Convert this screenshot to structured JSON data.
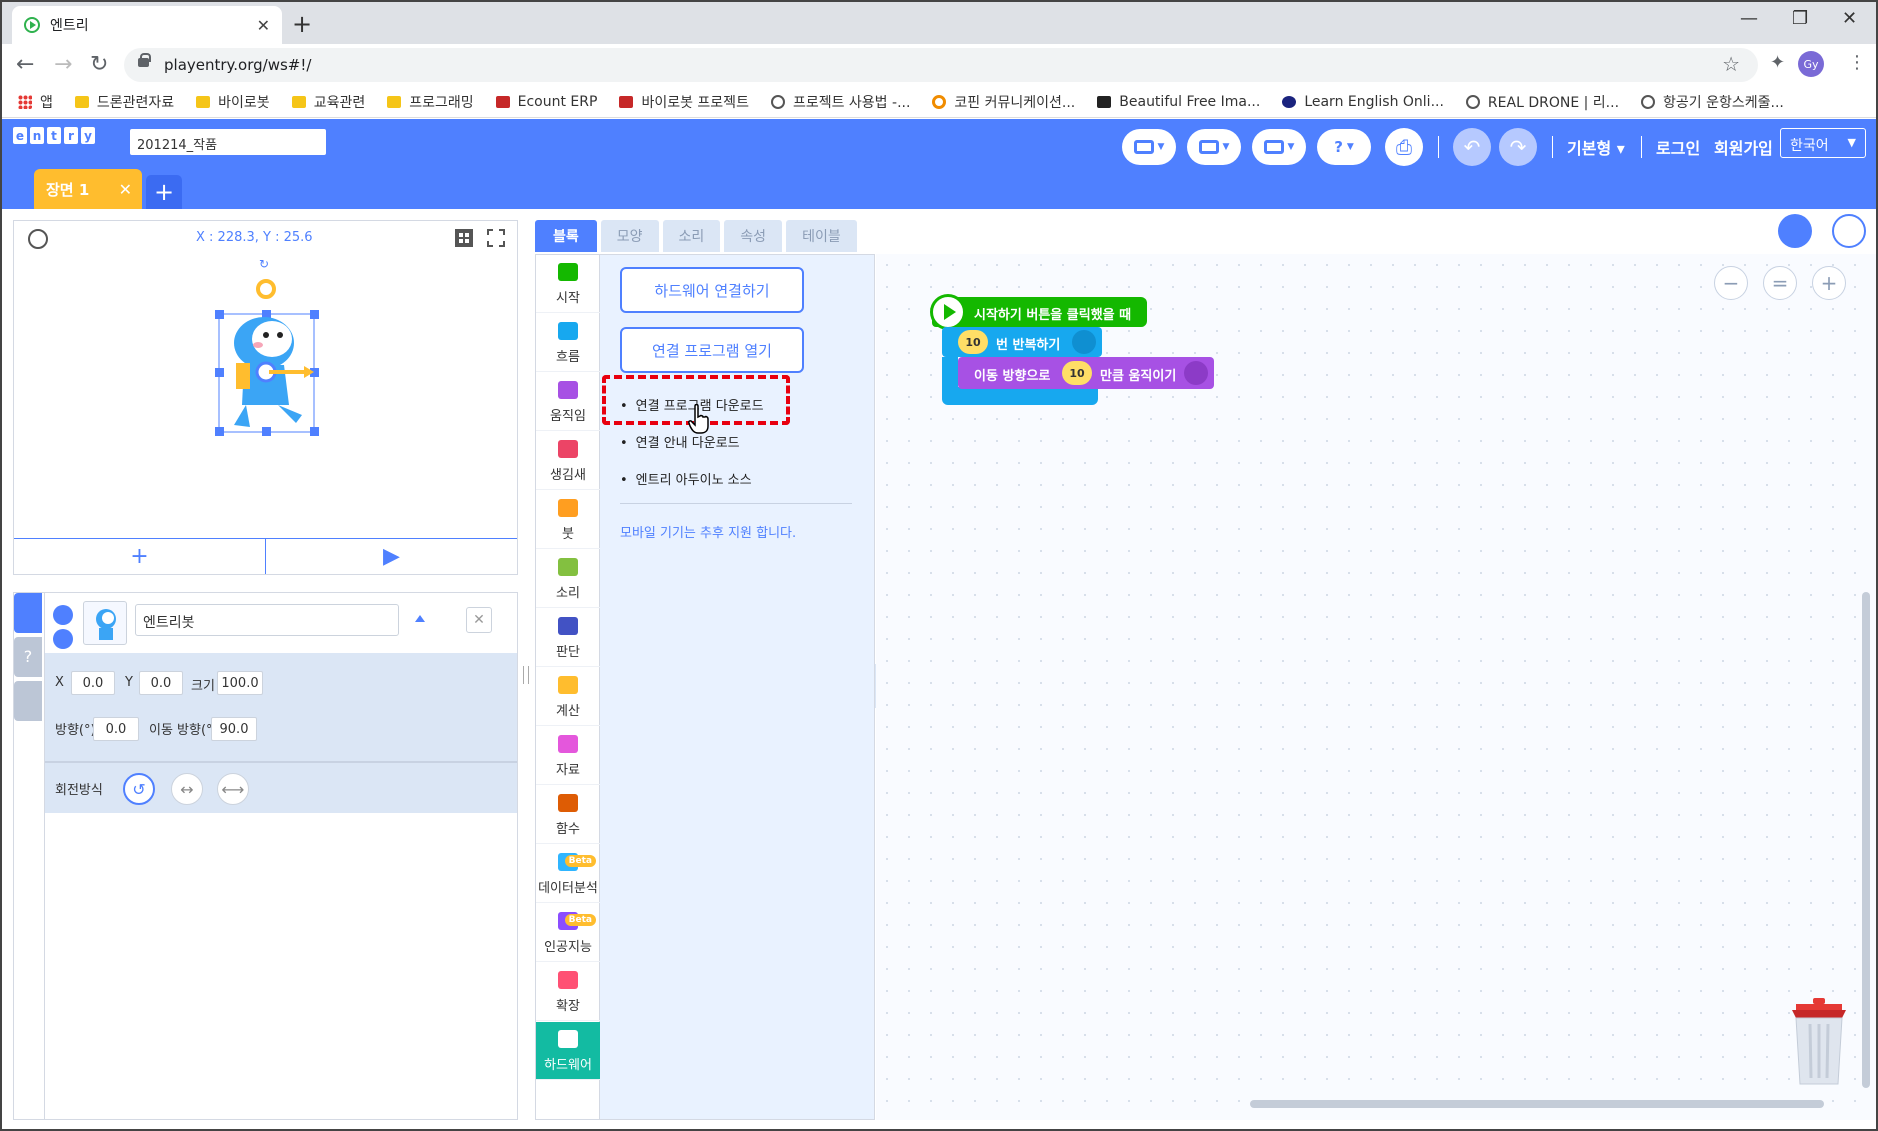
{
  "browser": {
    "tab_title": "엔트리",
    "url": "playentry.org/ws#!/",
    "profile_initials": "Gy",
    "bookmarks": [
      "앱",
      "드론관련자료",
      "바이로봇",
      "교육관련",
      "프로그래밍",
      "Ecount ERP",
      "바이로봇 프로젝트",
      "프로젝트 사용법 -...",
      "코핀 커뮤니케이션...",
      "Beautiful Free Ima...",
      "Learn English Onli...",
      "REAL DRONE | 리...",
      "항공기 운항스케줄..."
    ]
  },
  "header": {
    "logo_letters": [
      "e",
      "n",
      "t",
      "r",
      "y"
    ],
    "project_name": "201214_작품",
    "mode_label": "기본형",
    "login_label": "로그인",
    "signup_label": "회원가입",
    "language": "한국어",
    "help_label": "?",
    "scene_tab": "장면 1",
    "accent_color": "#4f80ff"
  },
  "stage": {
    "coord_text": "X : 228.3, Y : 25.6"
  },
  "object": {
    "name": "엔트리봇",
    "x_label": "X",
    "x_value": "0.0",
    "y_label": "Y",
    "y_value": "0.0",
    "size_label": "크기",
    "size_value": "100.0",
    "dir_label": "방향(°)",
    "dir_value": "0.0",
    "move_dir_label": "이동 방향(°)",
    "move_dir_value": "90.0",
    "rotation_label": "회전방식"
  },
  "palette": {
    "tabs": [
      "블록",
      "모양",
      "소리",
      "속성",
      "테이블"
    ],
    "categories": [
      {
        "label": "시작",
        "color": "#14b800"
      },
      {
        "label": "흐름",
        "color": "#17a8ef"
      },
      {
        "label": "움직임",
        "color": "#a751e4"
      },
      {
        "label": "생김새",
        "color": "#ec4466"
      },
      {
        "label": "붓",
        "color": "#ff9e20"
      },
      {
        "label": "소리",
        "color": "#83c040"
      },
      {
        "label": "판단",
        "color": "#4252c4"
      },
      {
        "label": "계산",
        "color": "#ffbd2e"
      },
      {
        "label": "자료",
        "color": "#e457dc"
      },
      {
        "label": "함수",
        "color": "#de5c04"
      },
      {
        "label": "데이터분석",
        "color": "#2fb5ff"
      },
      {
        "label": "인공지능",
        "color": "#8b4dff"
      },
      {
        "label": "확장",
        "color": "#ff5174"
      },
      {
        "label": "하드웨어",
        "color": "#13bba2"
      }
    ],
    "beta_label": "Beta",
    "hw_connect_button": "하드웨어 연결하기",
    "hw_open_program_button": "연결 프로그램 열기",
    "links": [
      "연결 프로그램 다운로드",
      "연결 안내 다운로드",
      "엔트리 아두이노 소스"
    ],
    "mobile_note": "모바일 기기는 추후 지원 합니다."
  },
  "workspace": {
    "start_block": "시작하기 버튼을 클릭했을 때",
    "repeat_count": "10",
    "repeat_label": "번 반복하기",
    "move_prefix": "이동 방향으로",
    "move_value": "10",
    "move_suffix": "만큼 움직이기",
    "zoom_out": "−",
    "zoom_reset": "=",
    "zoom_in": "+"
  }
}
